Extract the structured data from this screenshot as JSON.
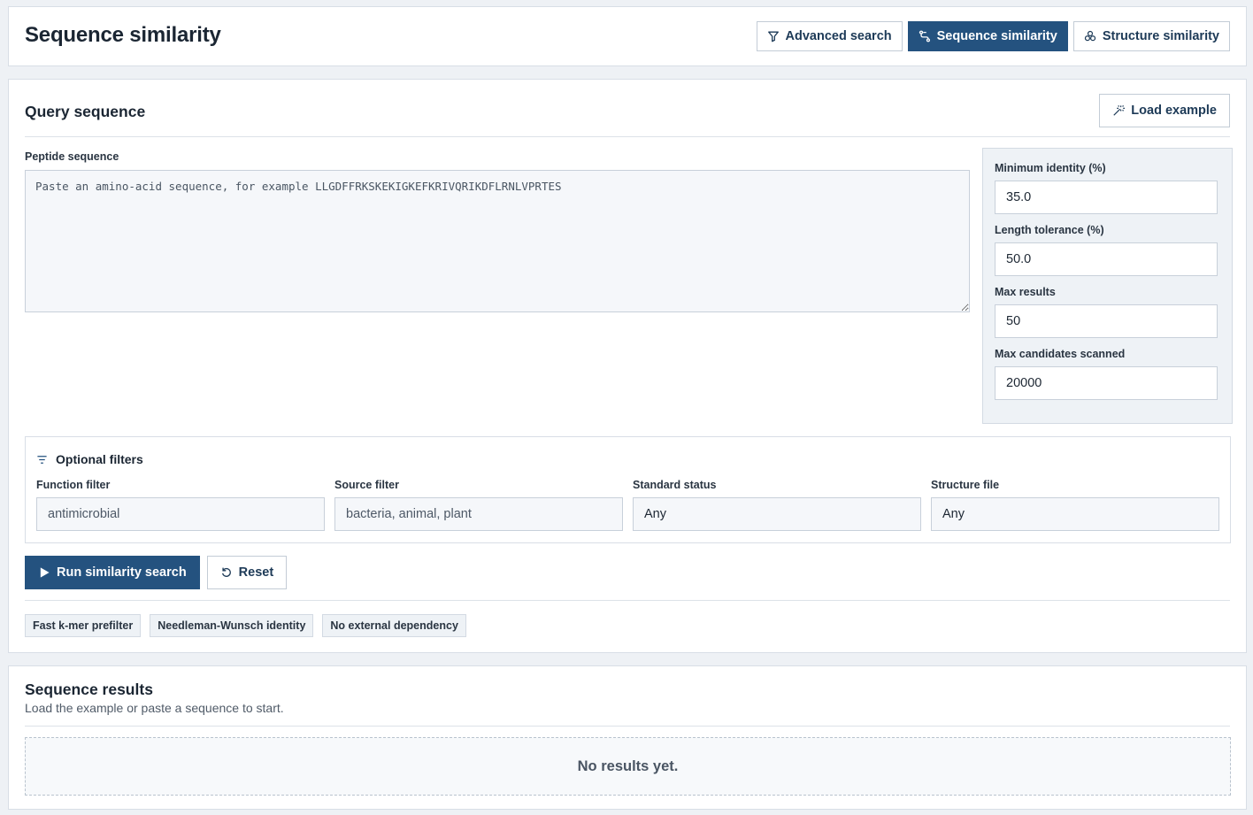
{
  "header": {
    "title": "Sequence similarity",
    "nav": {
      "advanced": "Advanced search",
      "sequence": "Sequence similarity",
      "structure": "Structure similarity"
    }
  },
  "query": {
    "title": "Query sequence",
    "load_example": "Load example",
    "peptide_label": "Peptide sequence",
    "peptide_placeholder": "Paste an amino-acid sequence, for example LLGDFFRKSKEKIGKEFKRIVQRIKDFLRNLVPRTES",
    "peptide_value": ""
  },
  "params": {
    "min_identity": {
      "label": "Minimum identity (%)",
      "value": "35.0"
    },
    "length_tolerance": {
      "label": "Length tolerance (%)",
      "value": "50.0"
    },
    "max_results": {
      "label": "Max results",
      "value": "50"
    },
    "max_candidates": {
      "label": "Max candidates scanned",
      "value": "20000"
    }
  },
  "filters": {
    "title": "Optional filters",
    "function": {
      "label": "Function filter",
      "placeholder": "antimicrobial",
      "value": ""
    },
    "source": {
      "label": "Source filter",
      "placeholder": "bacteria, animal, plant",
      "value": ""
    },
    "standard_status": {
      "label": "Standard status",
      "selected": "Any"
    },
    "structure_file": {
      "label": "Structure file",
      "selected": "Any"
    }
  },
  "actions": {
    "run": "Run similarity search",
    "reset": "Reset"
  },
  "chips": [
    "Fast k-mer prefilter",
    "Needleman-Wunsch identity",
    "No external dependency"
  ],
  "results": {
    "title": "Sequence results",
    "subtitle": "Load the example or paste a sequence to start.",
    "empty": "No results yet."
  },
  "colors": {
    "accent": "#24527f",
    "page_bg": "#eef1f5",
    "panel_bg": "#eef2f6"
  },
  "icons": {
    "advanced": "filter-icon",
    "sequence": "branch-icon",
    "structure": "cluster-icon",
    "load_example": "magic-wand-icon",
    "filters": "filter-lines-icon",
    "run": "play-icon",
    "reset": "refresh-icon"
  }
}
